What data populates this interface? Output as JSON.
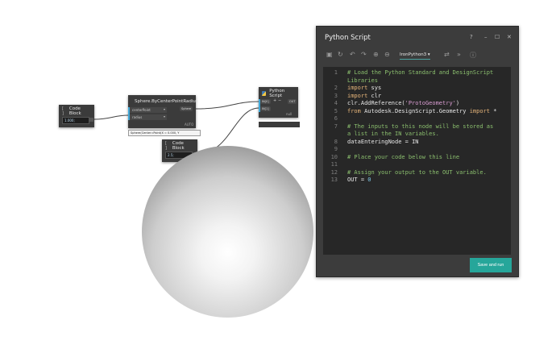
{
  "nodes": {
    "code_block_1": {
      "title": "Code Block",
      "value": "1.000;"
    },
    "sphere_node": {
      "title": "Sphere.ByCenterPointRadius",
      "inputs": [
        "centerPoint",
        "radius"
      ],
      "output": "Sphere",
      "lacing": "AUTO",
      "preview": "Sphere(Center=Point(X = 0.000, Y"
    },
    "code_block_2": {
      "title": "Code Block",
      "value": "2.5;"
    },
    "python_node": {
      "title": "Python Script",
      "inputs": [
        "IN[0]",
        "IN[1]"
      ],
      "output": "OUT",
      "preview": "null"
    }
  },
  "editor": {
    "title": "Python Script",
    "engine": "IronPython3",
    "lines": [
      {
        "n": "1",
        "parts": [
          {
            "t": "# Load the Python Standard and DesignScript",
            "c": "cm"
          }
        ]
      },
      {
        "n": "",
        "parts": [
          {
            "t": "Libraries",
            "c": "cm"
          }
        ]
      },
      {
        "n": "2",
        "parts": [
          {
            "t": "import",
            "c": "kw"
          },
          {
            "t": " sys",
            "c": ""
          }
        ]
      },
      {
        "n": "3",
        "parts": [
          {
            "t": "import",
            "c": "kw"
          },
          {
            "t": " clr",
            "c": ""
          }
        ]
      },
      {
        "n": "4",
        "parts": [
          {
            "t": "clr.AddReference(",
            "c": ""
          },
          {
            "t": "'ProtoGeometry'",
            "c": "st"
          },
          {
            "t": ")",
            "c": ""
          }
        ]
      },
      {
        "n": "5",
        "parts": [
          {
            "t": "from",
            "c": "kw"
          },
          {
            "t": " Autodesk.DesignScript.Geometry ",
            "c": ""
          },
          {
            "t": "import",
            "c": "kw"
          },
          {
            "t": " *",
            "c": ""
          }
        ]
      },
      {
        "n": "6",
        "parts": []
      },
      {
        "n": "7",
        "parts": [
          {
            "t": "# The inputs to this node will be stored as",
            "c": "cm"
          }
        ]
      },
      {
        "n": "",
        "parts": [
          {
            "t": "a list in the IN variables.",
            "c": "cm"
          }
        ]
      },
      {
        "n": "8",
        "parts": [
          {
            "t": "dataEnteringNode = IN",
            "c": ""
          }
        ]
      },
      {
        "n": "9",
        "parts": []
      },
      {
        "n": "10",
        "parts": [
          {
            "t": "# Place your code below this line",
            "c": "cm"
          }
        ]
      },
      {
        "n": "11",
        "parts": []
      },
      {
        "n": "12",
        "parts": [
          {
            "t": "# Assign your output to the OUT variable.",
            "c": "cm"
          }
        ]
      },
      {
        "n": "13",
        "parts": [
          {
            "t": "OUT = ",
            "c": ""
          },
          {
            "t": "0",
            "c": "nm"
          }
        ]
      }
    ],
    "save_run_label": "Save and run"
  },
  "icons": {
    "save": "save-icon",
    "reset": "reset-icon",
    "undo": "undo-icon",
    "redo": "redo-icon",
    "zoom_in": "zoom-in-icon",
    "zoom_out": "zoom-out-icon",
    "migrate": "migrate-icon",
    "more": "more-icon",
    "help": "help-icon"
  }
}
